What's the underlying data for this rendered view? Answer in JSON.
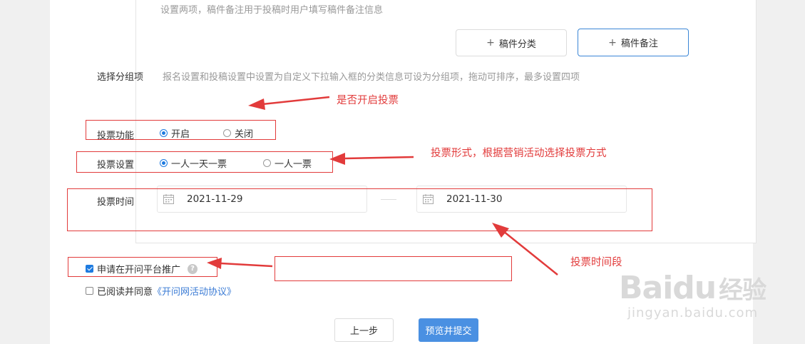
{
  "top_hint": "设置两项，稿件备注用于投稿时用户填写稿件备注信息",
  "buttons": {
    "category": "稿件分类",
    "remark": "稿件备注",
    "plus": "+",
    "prev": "上一步",
    "submit": "预览并提交"
  },
  "group": {
    "label": "选择分组项",
    "hint": "报名设置和投稿设置中设置为自定义下拉输入框的分类信息可设为分组项，拖动可排序，最多设置四项"
  },
  "vote_function": {
    "label": "投票功能",
    "options": [
      "开启",
      "关闭"
    ],
    "selected": "开启"
  },
  "vote_setting": {
    "label": "投票设置",
    "options": [
      "一人一天一票",
      "一人一票"
    ],
    "selected": "一人一天一票"
  },
  "vote_time": {
    "label": "投票时间",
    "start": "2021-11-29",
    "end": "2021-11-30"
  },
  "platform": {
    "label": "申请在开问平台推广",
    "checked": true,
    "help": "?"
  },
  "agreement": {
    "prefix": "已阅读并同意",
    "link": "《开问网活动协议》",
    "checked": false
  },
  "annotations": {
    "a1": "是否开启投票",
    "a2": "投票形式，根据营销活动选择投票方式",
    "a3": "投票时间段"
  },
  "watermark": {
    "brand": "Baidu",
    "brand_cn": "经验",
    "url": "jingyan.baidu.com"
  },
  "colors": {
    "annotation_red": "#e23b3b",
    "primary_blue": "#4a90e2",
    "radio_blue": "#1e7be0"
  }
}
